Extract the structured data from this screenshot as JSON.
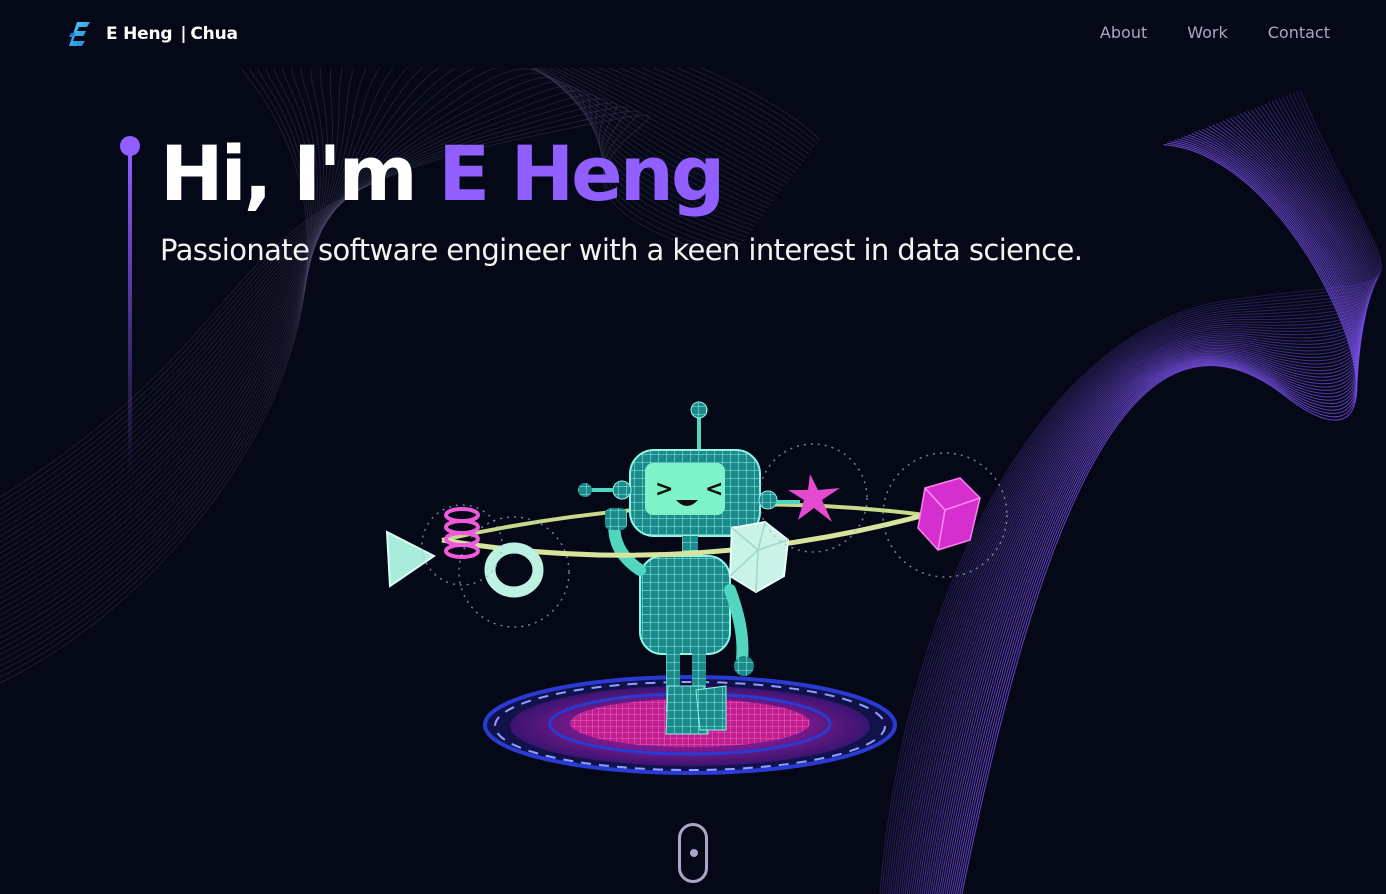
{
  "nav": {
    "logo_icon": "e-logo-icon",
    "logo_first": "E Heng",
    "logo_separator": "|",
    "logo_last": "Chua",
    "links": [
      "About",
      "Work",
      "Contact"
    ]
  },
  "hero": {
    "greeting": "Hi, I'm",
    "name": "E Heng",
    "subtitle": "Passionate software engineer with a keen interest in data science."
  },
  "scene": {
    "icon": "robot-3d-icon"
  },
  "scroll": {
    "icon": "mouse-scroll-icon"
  },
  "colors": {
    "background": "#050816",
    "accent": "#915eff",
    "nav_text": "#aaa6c3",
    "logo_cyan": "#29b6e8"
  }
}
